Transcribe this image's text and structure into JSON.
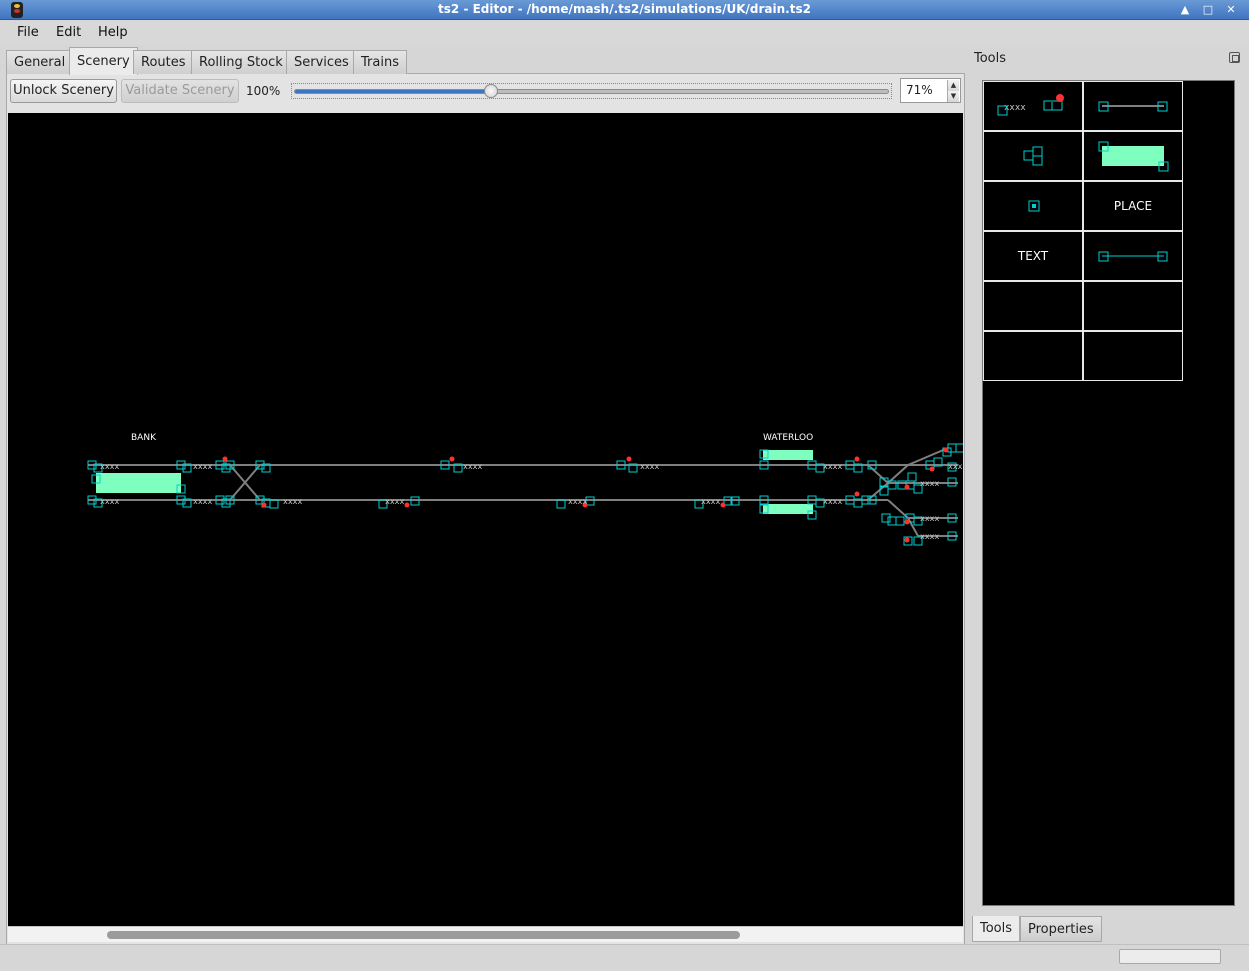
{
  "window": {
    "title": "ts2 - Editor - /home/mash/.ts2/simulations/UK/drain.ts2",
    "icons": [
      "app-signal-icon",
      "maximize-arrow-icon",
      "restore-icon",
      "close-icon"
    ]
  },
  "menu": [
    {
      "label": "File"
    },
    {
      "label": "Edit"
    },
    {
      "label": "Help"
    }
  ],
  "tabs": [
    {
      "label": "General",
      "active": false
    },
    {
      "label": "Scenery",
      "active": true
    },
    {
      "label": "Routes",
      "active": false
    },
    {
      "label": "Rolling Stock",
      "active": false
    },
    {
      "label": "Services",
      "active": false
    },
    {
      "label": "Trains",
      "active": false
    }
  ],
  "toolbar": {
    "unlock_label": "Unlock Scenery",
    "validate_label": "Validate Scenery",
    "zoom_min_label": "100%",
    "zoom_value": "71%",
    "slider_position": 0.33
  },
  "scene": {
    "colors": {
      "background": "#000000",
      "track": "#7f7f7f",
      "item": "#00d0d0",
      "platform": "#7fffbf",
      "signal": "#ff3030",
      "text": "#ffffff"
    },
    "place_labels": [
      "BANK",
      "WATERLOO"
    ],
    "marker_text": "xxxx"
  },
  "tools": {
    "title": "Tools",
    "items": [
      {
        "name": "signal-tool",
        "label": ""
      },
      {
        "name": "line-tool",
        "label": ""
      },
      {
        "name": "points-tool",
        "label": ""
      },
      {
        "name": "platform-tool",
        "label": ""
      },
      {
        "name": "end-tool",
        "label": ""
      },
      {
        "name": "place-tool",
        "label": "PLACE"
      },
      {
        "name": "text-tool",
        "label": "TEXT"
      },
      {
        "name": "invisible-link-tool",
        "label": ""
      }
    ],
    "signal_marker": "xxxx"
  },
  "bottom_tabs": [
    {
      "label": "Tools",
      "active": true
    },
    {
      "label": "Properties",
      "active": false
    }
  ]
}
